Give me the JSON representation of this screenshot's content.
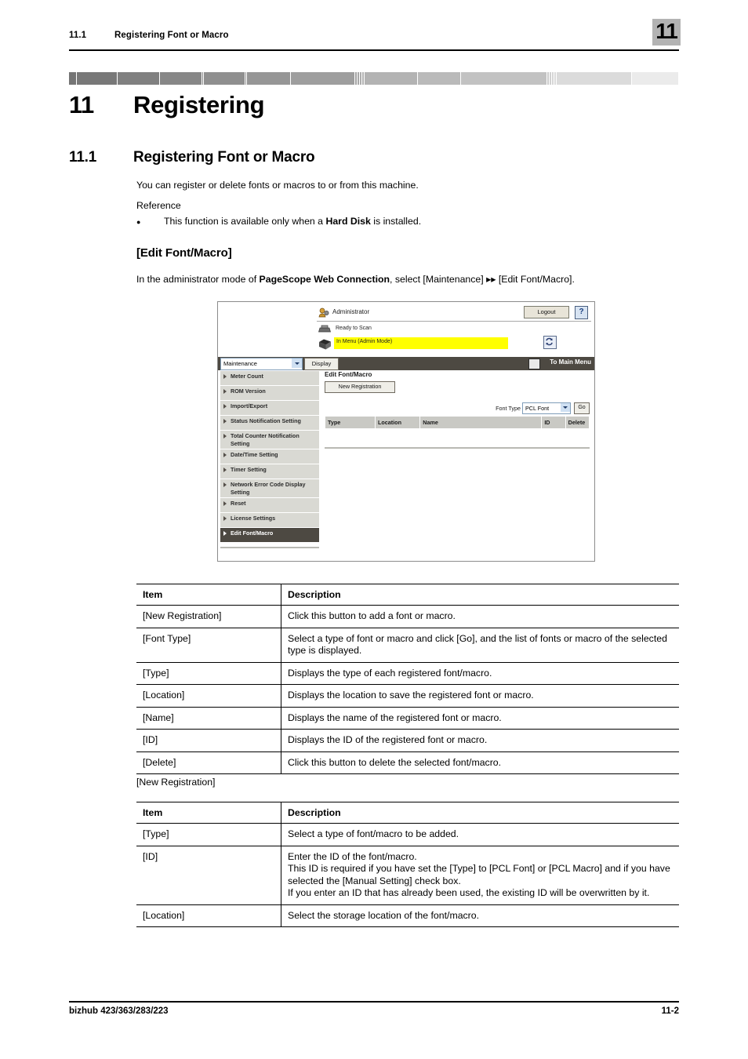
{
  "header": {
    "section_number": "11.1",
    "section_title": "Registering Font or Macro",
    "chapter_badge": "11"
  },
  "chapter": {
    "number": "11",
    "title": "Registering"
  },
  "section": {
    "number": "11.1",
    "title": "Registering Font or Macro"
  },
  "body": {
    "intro": "You can register or delete fonts or macros to or from this machine.",
    "reference_label": "Reference",
    "bullet_prefix": "This function is available only when a ",
    "bullet_bold": "Hard Disk",
    "bullet_suffix": " is installed.",
    "subheading": "[Edit Font/Macro]",
    "admin_prefix": "In the administrator mode of ",
    "admin_bold": "PageScope Web Connection",
    "admin_suffix": ", select [Maintenance] ▸▸ [Edit Font/Macro]."
  },
  "screenshot": {
    "admin_label": "Administrator",
    "logout_label": "Logout",
    "help_label": "?",
    "status_ready": "Ready to Scan",
    "status_menu": "In Menu (Admin Mode)",
    "refresh_icon": "refresh-icon",
    "admin_icon": "administrator-icon",
    "printer_icon": "printer-icon",
    "menu_icon": "printer-menu-icon",
    "toolbar": {
      "category_select": "Maintenance",
      "display_button": "Display",
      "main_menu_label": "To Main Menu",
      "main_menu_icon": "main-menu-icon"
    },
    "nav_items": [
      {
        "label": "Meter Count",
        "selected": false
      },
      {
        "label": "ROM Version",
        "selected": false
      },
      {
        "label": "Import/Export",
        "selected": false
      },
      {
        "label": "Status Notification Setting",
        "selected": false
      },
      {
        "label": "Total Counter Notification Setting",
        "selected": false
      },
      {
        "label": "Date/Time Setting",
        "selected": false
      },
      {
        "label": "Timer Setting",
        "selected": false
      },
      {
        "label": "Network Error Code Display Setting",
        "selected": false
      },
      {
        "label": "Reset",
        "selected": false
      },
      {
        "label": "License Settings",
        "selected": false
      },
      {
        "label": "Edit Font/Macro",
        "selected": true
      }
    ],
    "main": {
      "title": "Edit Font/Macro",
      "new_registration_button": "New Registration",
      "font_type_label": "Font Type",
      "font_type_value": "PCL Font",
      "go_button": "Go",
      "table_headers": [
        "Type",
        "Location",
        "Name",
        "ID",
        "Delete"
      ]
    },
    "colors": {
      "toolbar_bg": "#4d4942",
      "nav_bg": "#d9d9d3",
      "nav_selected_bg": "#4d4942",
      "highlight": "#ffff00",
      "table_header_bg": "#c9c9c4"
    }
  },
  "table1": {
    "headers": [
      "Item",
      "Description"
    ],
    "rows": [
      {
        "item": "[New Registration]",
        "description": "Click this button to add a font or macro."
      },
      {
        "item": "[Font Type]",
        "description": "Select a type of font or macro and click [Go], and the list of fonts or macro of the selected type is displayed."
      },
      {
        "item": "[Type]",
        "description": "Displays the type of each registered font/macro."
      },
      {
        "item": "[Location]",
        "description": "Displays the location to save the registered font or macro."
      },
      {
        "item": "[Name]",
        "description": "Displays the name of the registered font or macro."
      },
      {
        "item": "[ID]",
        "description": "Displays the ID of the registered font or macro."
      },
      {
        "item": "[Delete]",
        "description": "Click this button to delete the selected font/macro."
      }
    ]
  },
  "table2_caption": "[New Registration]",
  "table2": {
    "headers": [
      "Item",
      "Description"
    ],
    "rows": [
      {
        "item": "[Type]",
        "description": "Select a type of font/macro to be added."
      },
      {
        "item": "[ID]",
        "description": "Enter the ID of the font/macro.\nThis ID is required if you have set the [Type] to [PCL Font] or [PCL Macro] and if you have selected the [Manual Setting] check box.\nIf you enter an ID that has already been used, the existing ID will be overwritten by it."
      },
      {
        "item": "[Location]",
        "description": "Select the storage location of the font/macro."
      }
    ]
  },
  "footer": {
    "model": "bizhub 423/363/283/223",
    "page": "11-2"
  }
}
